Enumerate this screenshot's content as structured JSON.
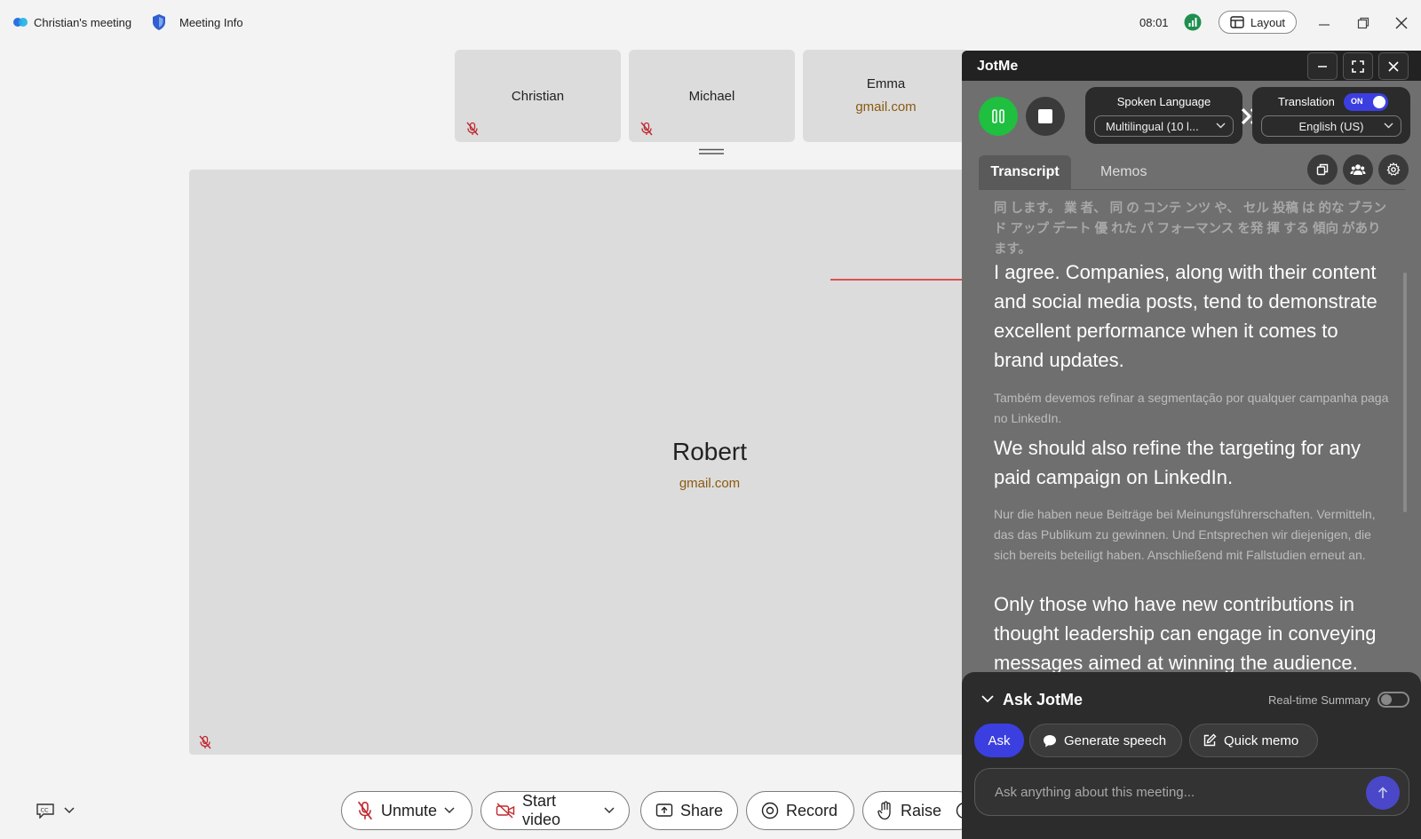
{
  "titlebar": {
    "meeting_name": "Christian's meeting",
    "meeting_info": "Meeting Info",
    "time": "08:01",
    "layout_label": "Layout"
  },
  "participants": [
    {
      "name": "Christian",
      "email": ""
    },
    {
      "name": "Michael",
      "email": ""
    },
    {
      "name": "Emma",
      "email": "gmail.com"
    }
  ],
  "stage": {
    "name": "Robert",
    "email": "gmail.com"
  },
  "toolbar": {
    "unmute": "Unmute",
    "start_video": "Start video",
    "share": "Share",
    "record": "Record",
    "raise": "Raise"
  },
  "jotme": {
    "title": "JotMe",
    "spoken_language_label": "Spoken Language",
    "spoken_language_value": "Multilingual (10 l...",
    "translation_label": "Translation",
    "translation_toggle": "ON",
    "translation_value": "English (US)",
    "tabs": {
      "transcript": "Transcript",
      "memos": "Memos"
    },
    "transcript": [
      {
        "original": "同 します。 業 者、 同 の コンテ ンツ や、 セル 投稿 は 的な ブランド アップ デート 優 れた パ フォーマンス を発 揮 する 傾向 があります。",
        "translation": "I agree. Companies, along with their content and social media posts, tend to demonstrate excellent performance when it comes to brand updates."
      },
      {
        "original": "Também devemos refinar a segmentação por qualquer campanha paga no LinkedIn.",
        "translation": "We should also refine the targeting for any paid campaign on LinkedIn."
      },
      {
        "original": "Nur die haben neue Beiträge bei Meinungsführerschaften. Vermitteln, das das Publikum zu gewinnen. Und Entsprechen wir diejenigen, die sich bereits beteiligt haben. Anschließend mit Fallstudien erneut an.",
        "translation": "Only those who have new contributions in thought leadership can engage in conveying messages aimed at winning the audience."
      }
    ],
    "ask": {
      "title": "Ask JotMe",
      "realtime_summary": "Real-time Summary",
      "chips": {
        "ask": "Ask",
        "generate": "Generate speech",
        "memo": "Quick memo"
      },
      "placeholder": "Ask anything about this meeting..."
    }
  },
  "colors": {
    "accent_green": "#1fbf3f",
    "accent_blue": "#3c3fe0",
    "email_text": "#8a5a10",
    "panel_bg": "#6f6f6f",
    "mic_off_red": "#c0282f"
  }
}
